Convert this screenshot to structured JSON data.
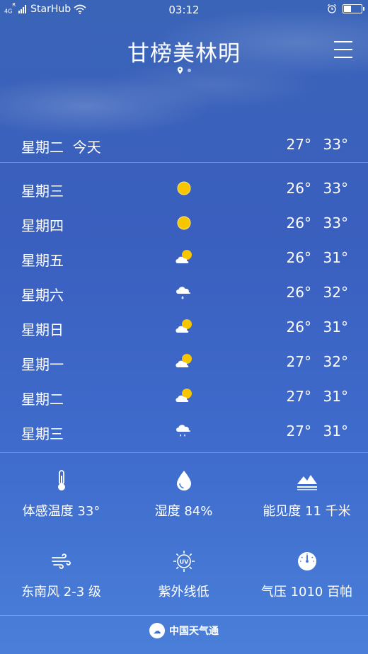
{
  "status_bar": {
    "network": "4G",
    "network_sup": "R",
    "carrier": "StarHub",
    "time": "03:12",
    "battery_level": 0.4
  },
  "header": {
    "city": "甘榜美林明",
    "menu_icon": "hamburger-menu-icon",
    "page_indicator": {
      "pages": 2,
      "current": 1,
      "location_icon": "location-pin-icon"
    }
  },
  "today": {
    "day": "星期二",
    "label": "今天",
    "low": "27°",
    "high": "33°"
  },
  "forecast": [
    {
      "day": "星期三",
      "icon": "sunny",
      "low": "26°",
      "high": "33°"
    },
    {
      "day": "星期四",
      "icon": "sunny",
      "low": "26°",
      "high": "33°"
    },
    {
      "day": "星期五",
      "icon": "partly-cloudy",
      "low": "26°",
      "high": "31°"
    },
    {
      "day": "星期六",
      "icon": "light-rain",
      "low": "26°",
      "high": "32°"
    },
    {
      "day": "星期日",
      "icon": "partly-cloudy",
      "low": "26°",
      "high": "31°"
    },
    {
      "day": "星期一",
      "icon": "partly-cloudy",
      "low": "27°",
      "high": "32°"
    },
    {
      "day": "星期二",
      "icon": "partly-cloudy",
      "low": "27°",
      "high": "31°"
    },
    {
      "day": "星期三",
      "icon": "rain",
      "low": "27°",
      "high": "31°"
    }
  ],
  "details": [
    {
      "icon": "thermometer-icon",
      "label": "体感温度 33°"
    },
    {
      "icon": "humidity-drop-icon",
      "label": "湿度 84%"
    },
    {
      "icon": "visibility-mountain-icon",
      "label": "能见度 11 千米"
    },
    {
      "icon": "wind-icon",
      "label": "东南风 2-3 级"
    },
    {
      "icon": "uv-icon",
      "label": "紫外线低"
    },
    {
      "icon": "pressure-gauge-icon",
      "label": "气压 1010 百帕"
    }
  ],
  "footer": {
    "provider": "中国天气通",
    "logo_icon": "provider-logo-icon"
  },
  "colors": {
    "bg_top": "#3a64b8",
    "bg_bottom": "#4a7fd9",
    "sun": "#f7c600",
    "text": "#ffffff"
  }
}
